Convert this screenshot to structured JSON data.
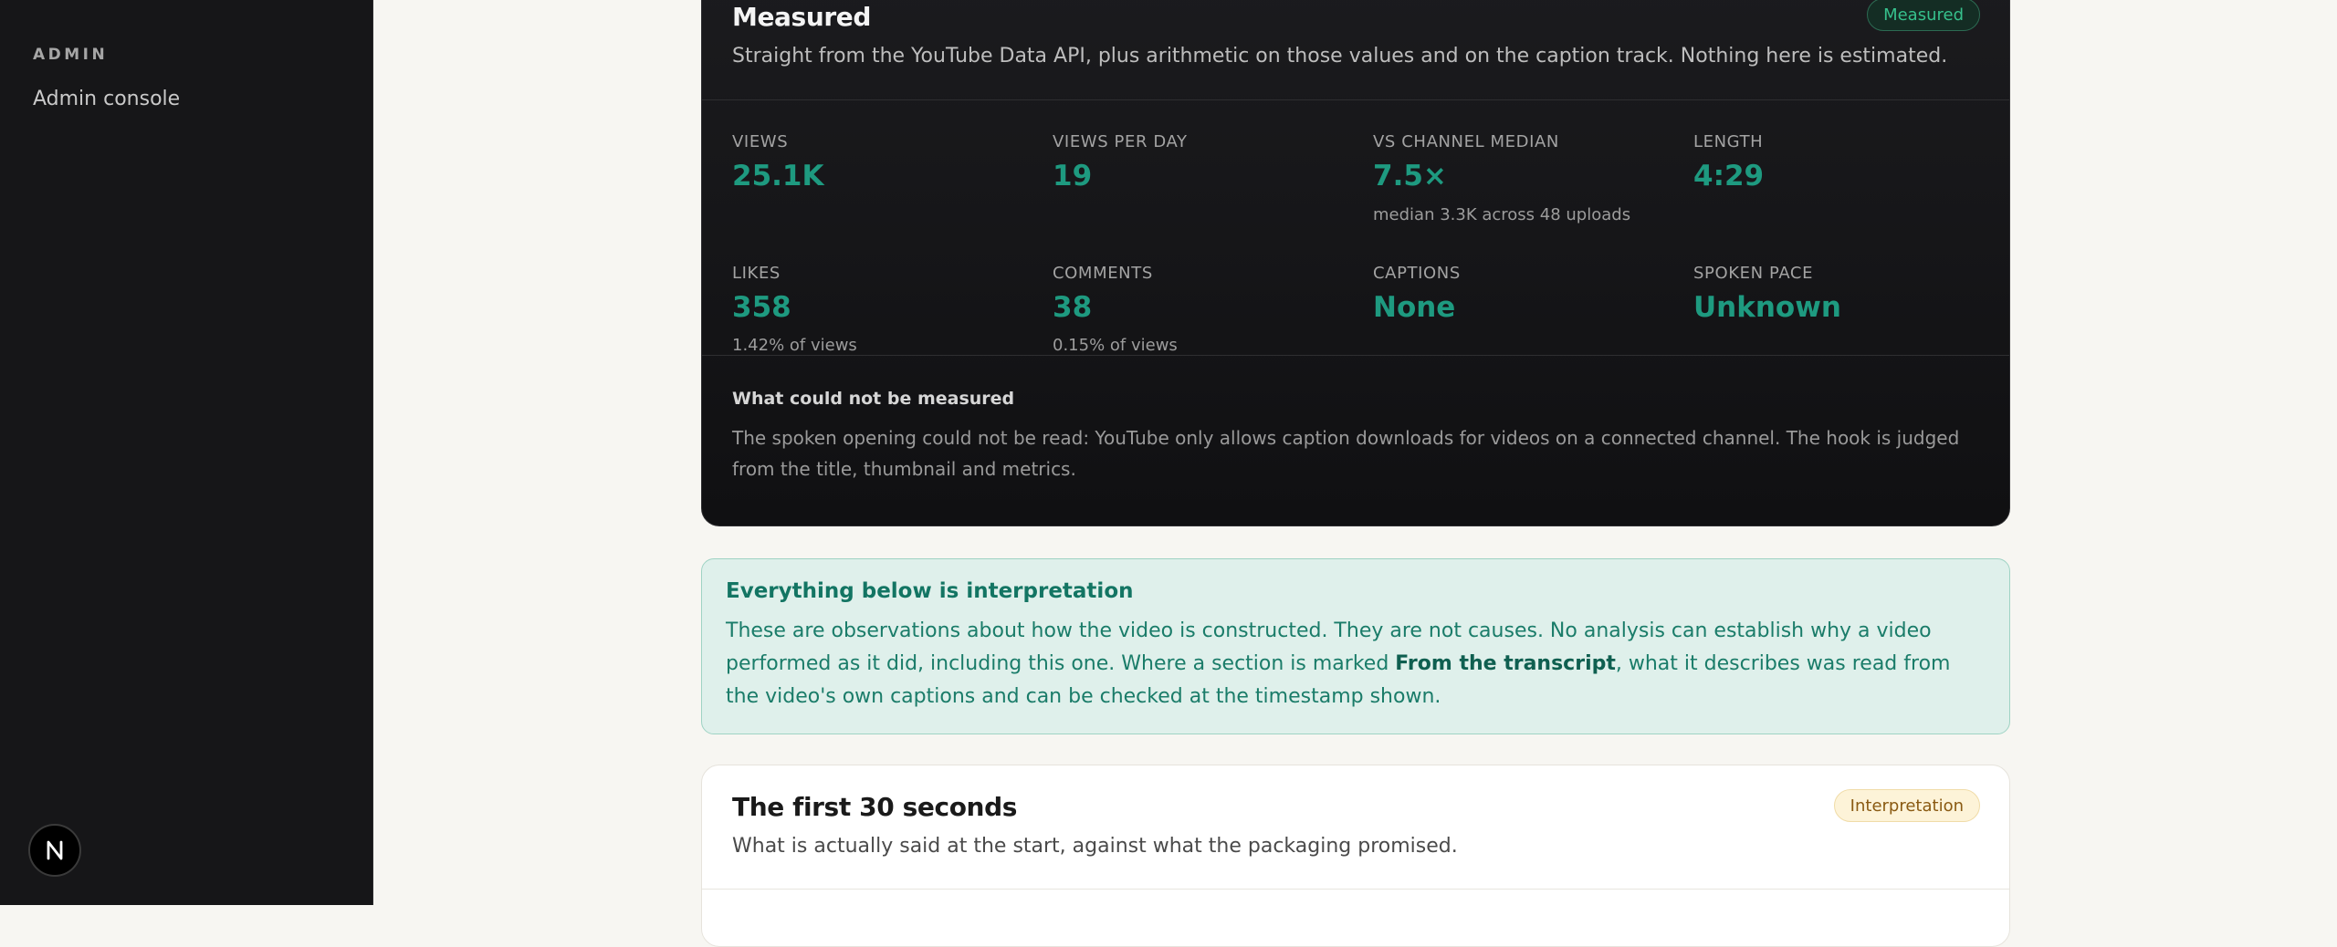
{
  "sidebar": {
    "section_label": "ADMIN",
    "items": [
      {
        "label": "Admin console"
      }
    ],
    "avatar_letter": "N"
  },
  "measured": {
    "title": "Measured",
    "badge": "Measured",
    "subtitle": "Straight from the YouTube Data API, plus arithmetic on those values and on the caption track. Nothing here is estimated.",
    "metrics": [
      {
        "label": "VIEWS",
        "value": "25.1K",
        "note": ""
      },
      {
        "label": "VIEWS PER DAY",
        "value": "19",
        "note": ""
      },
      {
        "label": "VS CHANNEL MEDIAN",
        "value": "7.5×",
        "note": "median 3.3K across 48 uploads"
      },
      {
        "label": "LENGTH",
        "value": "4:29",
        "note": ""
      },
      {
        "label": "LIKES",
        "value": "358",
        "note": "1.42% of views"
      },
      {
        "label": "COMMENTS",
        "value": "38",
        "note": "0.15% of views"
      },
      {
        "label": "CAPTIONS",
        "value": "None",
        "note": ""
      },
      {
        "label": "SPOKEN PACE",
        "value": "Unknown",
        "note": ""
      }
    ],
    "not_measured_title": "What could not be measured",
    "not_measured_body": "The spoken opening could not be read: YouTube only allows caption downloads for videos on a connected channel. The hook is judged from the title, thumbnail and metrics."
  },
  "interpretation_banner": {
    "title": "Everything below is interpretation",
    "body_before": "These are observations about how the video is constructed. They are not causes. No analysis can establish why a video performed as it did, including this one. Where a section is marked ",
    "body_bold": "From the transcript",
    "body_after": ", what it describes was read from the video's own captions and can be checked at the timestamp shown."
  },
  "first30": {
    "title": "The first 30 seconds",
    "badge": "Interpretation",
    "subtitle": "What is actually said at the start, against what the packaging promised."
  }
}
